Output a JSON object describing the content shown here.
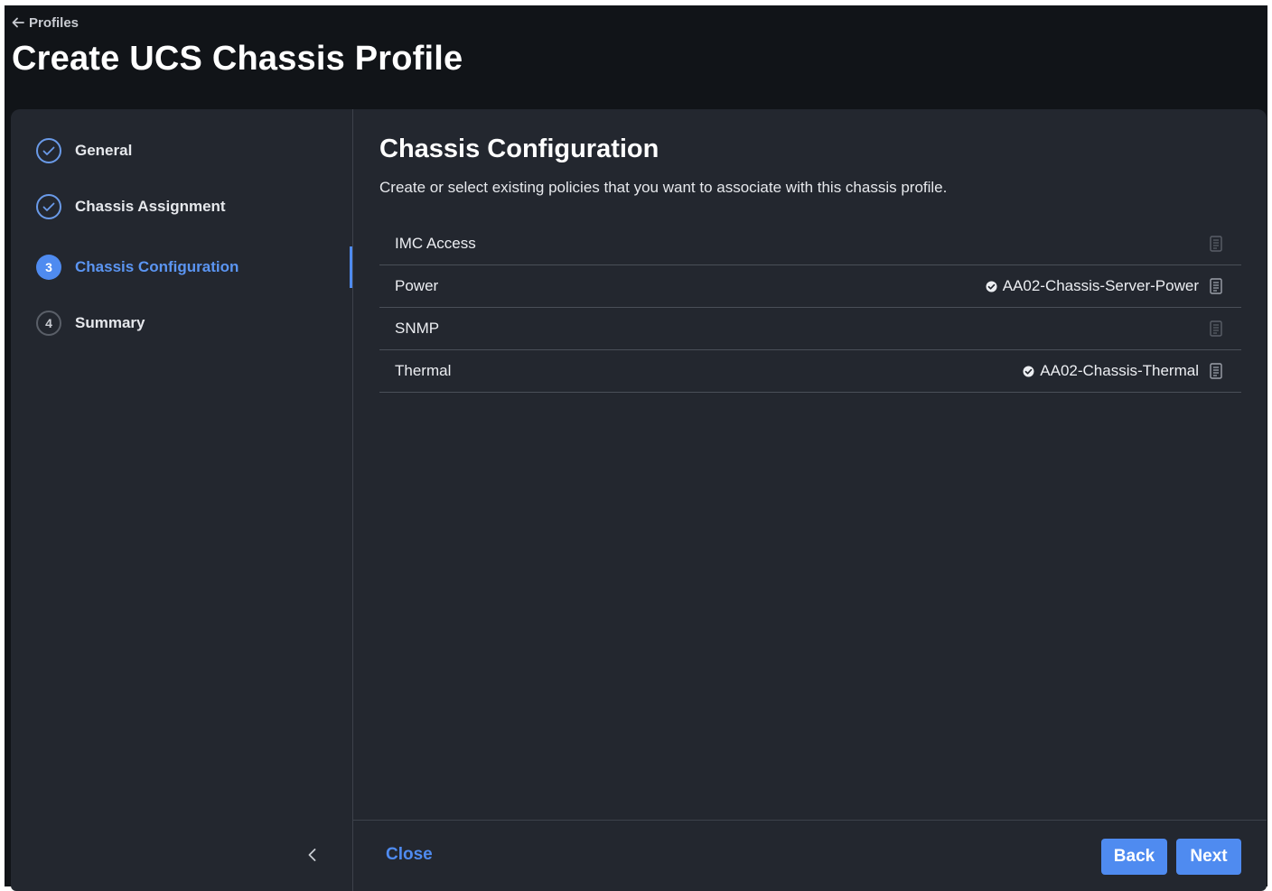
{
  "header": {
    "back_label": "Profiles",
    "title": "Create UCS Chassis Profile"
  },
  "steps": [
    {
      "number": "1",
      "label": "General",
      "state": "completed"
    },
    {
      "number": "2",
      "label": "Chassis Assignment",
      "state": "completed"
    },
    {
      "number": "3",
      "label": "Chassis Configuration",
      "state": "active"
    },
    {
      "number": "4",
      "label": "Summary",
      "state": "pending"
    }
  ],
  "content": {
    "title": "Chassis Configuration",
    "description": "Create or select existing policies that you want to associate with this chassis profile.",
    "policies": [
      {
        "name": "IMC Access",
        "value": ""
      },
      {
        "name": "Power",
        "value": "AA02-Chassis-Server-Power"
      },
      {
        "name": "SNMP",
        "value": ""
      },
      {
        "name": "Thermal",
        "value": "AA02-Chassis-Thermal"
      }
    ]
  },
  "footer": {
    "close_label": "Close",
    "back_label": "Back",
    "next_label": "Next"
  },
  "colors": {
    "accent": "#4f8bf0",
    "panel_bg": "#23272f",
    "page_bg": "#111418"
  },
  "icons": {
    "back": "arrow-left-icon",
    "step_done": "check-circle-icon",
    "assigned": "check-badge-icon",
    "policy_detail": "document-icon",
    "collapse": "chevron-left-icon"
  }
}
